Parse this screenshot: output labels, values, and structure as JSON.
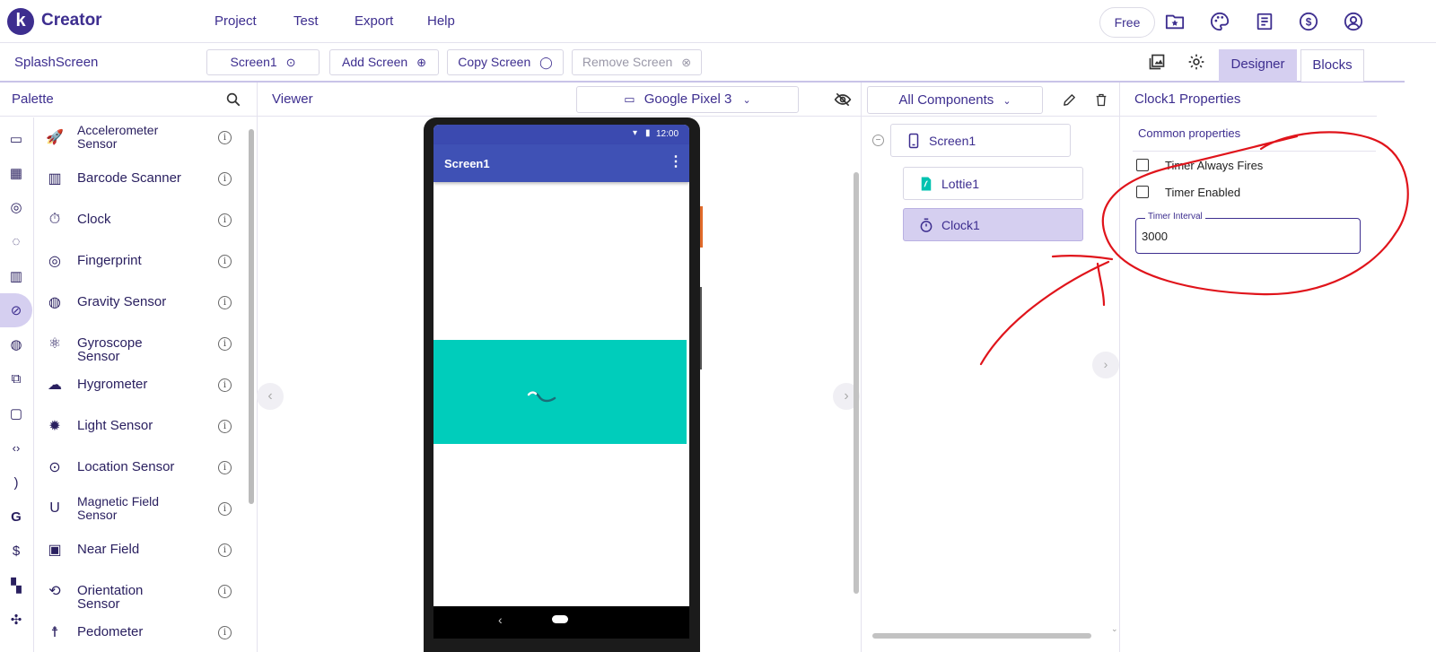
{
  "app": {
    "logo_letter": "k",
    "name": "Creator"
  },
  "menu": {
    "items": [
      "Project",
      "Test",
      "Export",
      "Help"
    ]
  },
  "header_actions": {
    "plan_label": "Free",
    "icons": [
      "folder-star-icon",
      "palette-icon",
      "book-icon",
      "dollar-icon",
      "account-icon"
    ]
  },
  "toolbar": {
    "project_name": "SplashScreen",
    "screen_select": "Screen1",
    "add_screen": "Add Screen",
    "copy_screen": "Copy Screen",
    "remove_screen": "Remove Screen",
    "designer_tab": "Designer",
    "blocks_tab": "Blocks"
  },
  "palette": {
    "title": "Palette",
    "items": [
      {
        "label": "Accelerometer Sensor",
        "icon": "rocket-icon"
      },
      {
        "label": "Barcode Scanner",
        "icon": "barcode-icon"
      },
      {
        "label": "Clock",
        "icon": "stopwatch-icon"
      },
      {
        "label": "Fingerprint",
        "icon": "fingerprint-icon"
      },
      {
        "label": "Gravity Sensor",
        "icon": "globe-icon"
      },
      {
        "label": "Gyroscope Sensor",
        "icon": "atom-icon"
      },
      {
        "label": "Hygrometer",
        "icon": "cloud-drops-icon"
      },
      {
        "label": "Light Sensor",
        "icon": "light-bulb-icon"
      },
      {
        "label": "Location Sensor",
        "icon": "crosshair-icon"
      },
      {
        "label": "Magnetic Field Sensor",
        "icon": "magnet-icon"
      },
      {
        "label": "Near Field",
        "icon": "nfc-icon"
      },
      {
        "label": "Orientation Sensor",
        "icon": "rotate-icon"
      },
      {
        "label": "Pedometer",
        "icon": "runner-icon"
      }
    ],
    "info_glyph": "i"
  },
  "viewer": {
    "title": "Viewer",
    "device": "Google Pixel 3",
    "phone": {
      "status_time": "12:00",
      "screen_title": "Screen1"
    }
  },
  "components": {
    "filter": "All Components",
    "tree": [
      {
        "label": "Screen1",
        "icon": "phone-icon",
        "selected": false
      },
      {
        "label": "Lottie1",
        "icon": "lottie-icon",
        "selected": false
      },
      {
        "label": "Clock1",
        "icon": "stopwatch-icon",
        "selected": true
      }
    ]
  },
  "properties": {
    "title": "Clock1 Properties",
    "section": "Common properties",
    "timer_always_fires": {
      "label": "Timer Always Fires",
      "checked": false
    },
    "timer_enabled": {
      "label": "Timer Enabled",
      "checked": false
    },
    "timer_interval": {
      "label": "Timer Interval",
      "value": "3000"
    }
  },
  "colors": {
    "brand": "#3d2e8f",
    "selected_bg": "#d5cff0",
    "appbar": "#3f51b5",
    "lottie_bg": "#00cdbb",
    "annotation": "#e0141b"
  }
}
